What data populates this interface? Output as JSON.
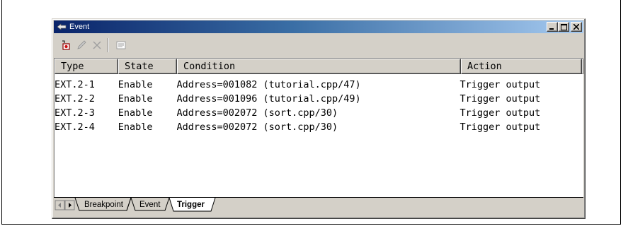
{
  "window": {
    "title": "Event"
  },
  "toolbar": {
    "buttons": [
      {
        "icon": "add-event-icon"
      },
      {
        "icon": "edit-pencil-icon"
      },
      {
        "icon": "delete-x-icon"
      },
      {
        "icon": "properties-icon"
      }
    ]
  },
  "table": {
    "columns": [
      "Type",
      "State",
      "Condition",
      "Action"
    ],
    "rows": [
      {
        "type": "EXT.2-1",
        "state": "Enable",
        "condition": "Address=001082 (tutorial.cpp/47)",
        "action": "Trigger output"
      },
      {
        "type": "EXT.2-2",
        "state": "Enable",
        "condition": "Address=001096 (tutorial.cpp/49)",
        "action": "Trigger output"
      },
      {
        "type": "EXT.2-3",
        "state": "Enable",
        "condition": "Address=002072 (sort.cpp/30)",
        "action": "Trigger output"
      },
      {
        "type": "EXT.2-4",
        "state": "Enable",
        "condition": "Address=002072 (sort.cpp/30)",
        "action": "Trigger output"
      }
    ]
  },
  "tabs": [
    {
      "label": "Breakpoint",
      "active": false
    },
    {
      "label": "Event",
      "active": false
    },
    {
      "label": "Trigger",
      "active": true
    }
  ]
}
